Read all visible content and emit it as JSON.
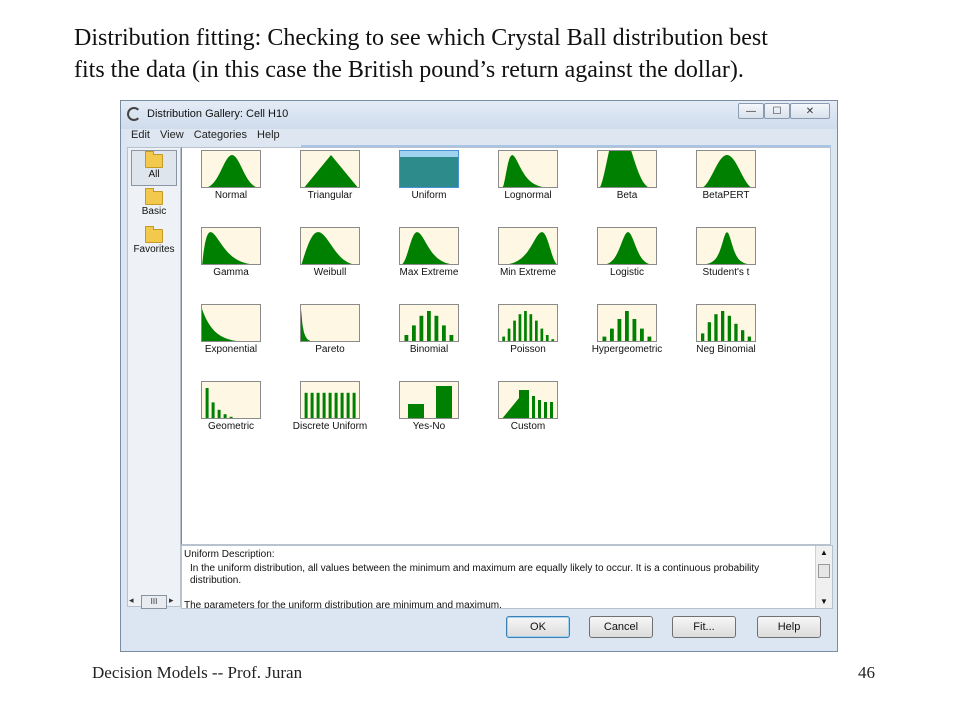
{
  "slide": {
    "title_line1": "Distribution fitting: Checking to see which Crystal Ball distribution best",
    "title_line2": "fits the data (in this case the British pound’s return against the dollar).",
    "footer_left": "Decision Models -- Prof. Juran",
    "page_number": "46"
  },
  "window": {
    "title": "Distribution Gallery: Cell H10",
    "minimize_glyph": "—",
    "maximize_glyph": "☐",
    "close_glyph": "✕"
  },
  "menu": [
    "Edit",
    "View",
    "Categories",
    "Help"
  ],
  "categories": [
    {
      "label": "All",
      "selected": true
    },
    {
      "label": "Basic",
      "selected": false
    },
    {
      "label": "Favorites",
      "selected": false
    }
  ],
  "sidebar_scroll": {
    "left": "◂",
    "thumb": "III",
    "right": "▸"
  },
  "distributions": [
    {
      "label": "Normal",
      "shape": "normal"
    },
    {
      "label": "Triangular",
      "shape": "triangular"
    },
    {
      "label": "Uniform",
      "shape": "uniform",
      "selected": true
    },
    {
      "label": "Lognormal",
      "shape": "lognormal"
    },
    {
      "label": "Beta",
      "shape": "beta"
    },
    {
      "label": "BetaPERT",
      "shape": "betapert"
    },
    {
      "label": "Gamma",
      "shape": "gamma"
    },
    {
      "label": "Weibull",
      "shape": "weibull"
    },
    {
      "label": "Max Extreme",
      "shape": "maxextreme"
    },
    {
      "label": "Min Extreme",
      "shape": "minextreme"
    },
    {
      "label": "Logistic",
      "shape": "logistic"
    },
    {
      "label": "Student's t",
      "shape": "studentt"
    },
    {
      "label": "Exponential",
      "shape": "exponential"
    },
    {
      "label": "Pareto",
      "shape": "pareto"
    },
    {
      "label": "Binomial",
      "shape": "binomial"
    },
    {
      "label": "Poisson",
      "shape": "poisson"
    },
    {
      "label": "Hypergeometric",
      "shape": "hypergeometric"
    },
    {
      "label": "Neg Binomial",
      "shape": "negbinomial"
    },
    {
      "label": "Geometric",
      "shape": "geometric"
    },
    {
      "label": "Discrete Uniform",
      "shape": "discreteuniform"
    },
    {
      "label": "Yes-No",
      "shape": "yesno"
    },
    {
      "label": "Custom",
      "shape": "custom"
    }
  ],
  "description": {
    "heading": "Uniform Description:",
    "text": "In the uniform distribution, all values between the minimum and maximum are equally likely to occur. It is a continuous probability distribution.",
    "parameters": "The parameters for the uniform distribution are minimum and maximum."
  },
  "buttons": {
    "ok": "OK",
    "cancel": "Cancel",
    "fit": "Fit...",
    "help": "Help"
  },
  "colors": {
    "curve_fill": "#008000",
    "uniform_fill": "#2e8b8b",
    "thumb_bg": "#fdf7e4"
  }
}
